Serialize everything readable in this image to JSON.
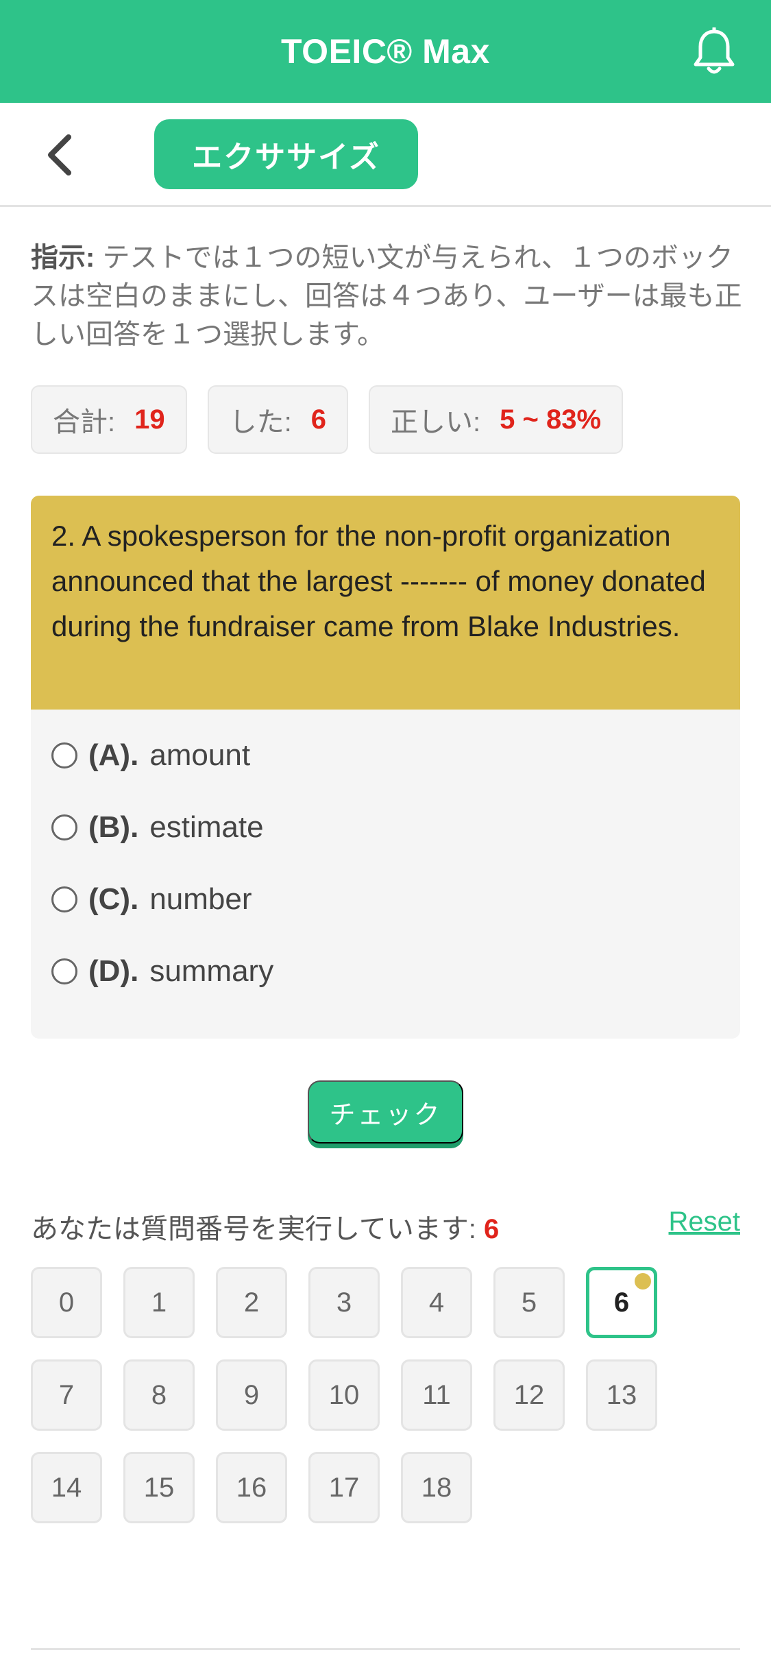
{
  "app": {
    "title": "TOEIC® Max",
    "icons": {
      "notification": "bell-icon",
      "back": "chevron-left-icon"
    },
    "accent_color": "#2ec389"
  },
  "subnav": {
    "tab_label": "エクササイズ"
  },
  "instruction": {
    "lead": "指示:",
    "text": " テストでは１つの短い文が与えられ、１つのボックスは空白のままにし、回答は４つあり、ユーザーは最も正しい回答を１つ選択します。"
  },
  "stats": [
    {
      "label": "合計:",
      "value": "19"
    },
    {
      "label": "した:",
      "value": "6"
    },
    {
      "label": "正しい:",
      "value": "5 ~ 83%"
    }
  ],
  "question": {
    "text": "2. A spokesperson for the non-profit organization announced that the largest ------- of money donated during the fundraiser came from Blake Industries.",
    "options": [
      {
        "letter": "(A).",
        "text": "amount"
      },
      {
        "letter": "(B).",
        "text": "estimate"
      },
      {
        "letter": "(C).",
        "text": "number"
      },
      {
        "letter": "(D).",
        "text": "summary"
      }
    ]
  },
  "check_button": "チェック",
  "progress": {
    "label": "あなたは質問番号を実行しています:",
    "current": "6",
    "reset_label": "Reset",
    "numbers": [
      "0",
      "1",
      "2",
      "3",
      "4",
      "5",
      "6",
      "7",
      "8",
      "9",
      "10",
      "11",
      "12",
      "13",
      "14",
      "15",
      "16",
      "17",
      "18"
    ]
  }
}
